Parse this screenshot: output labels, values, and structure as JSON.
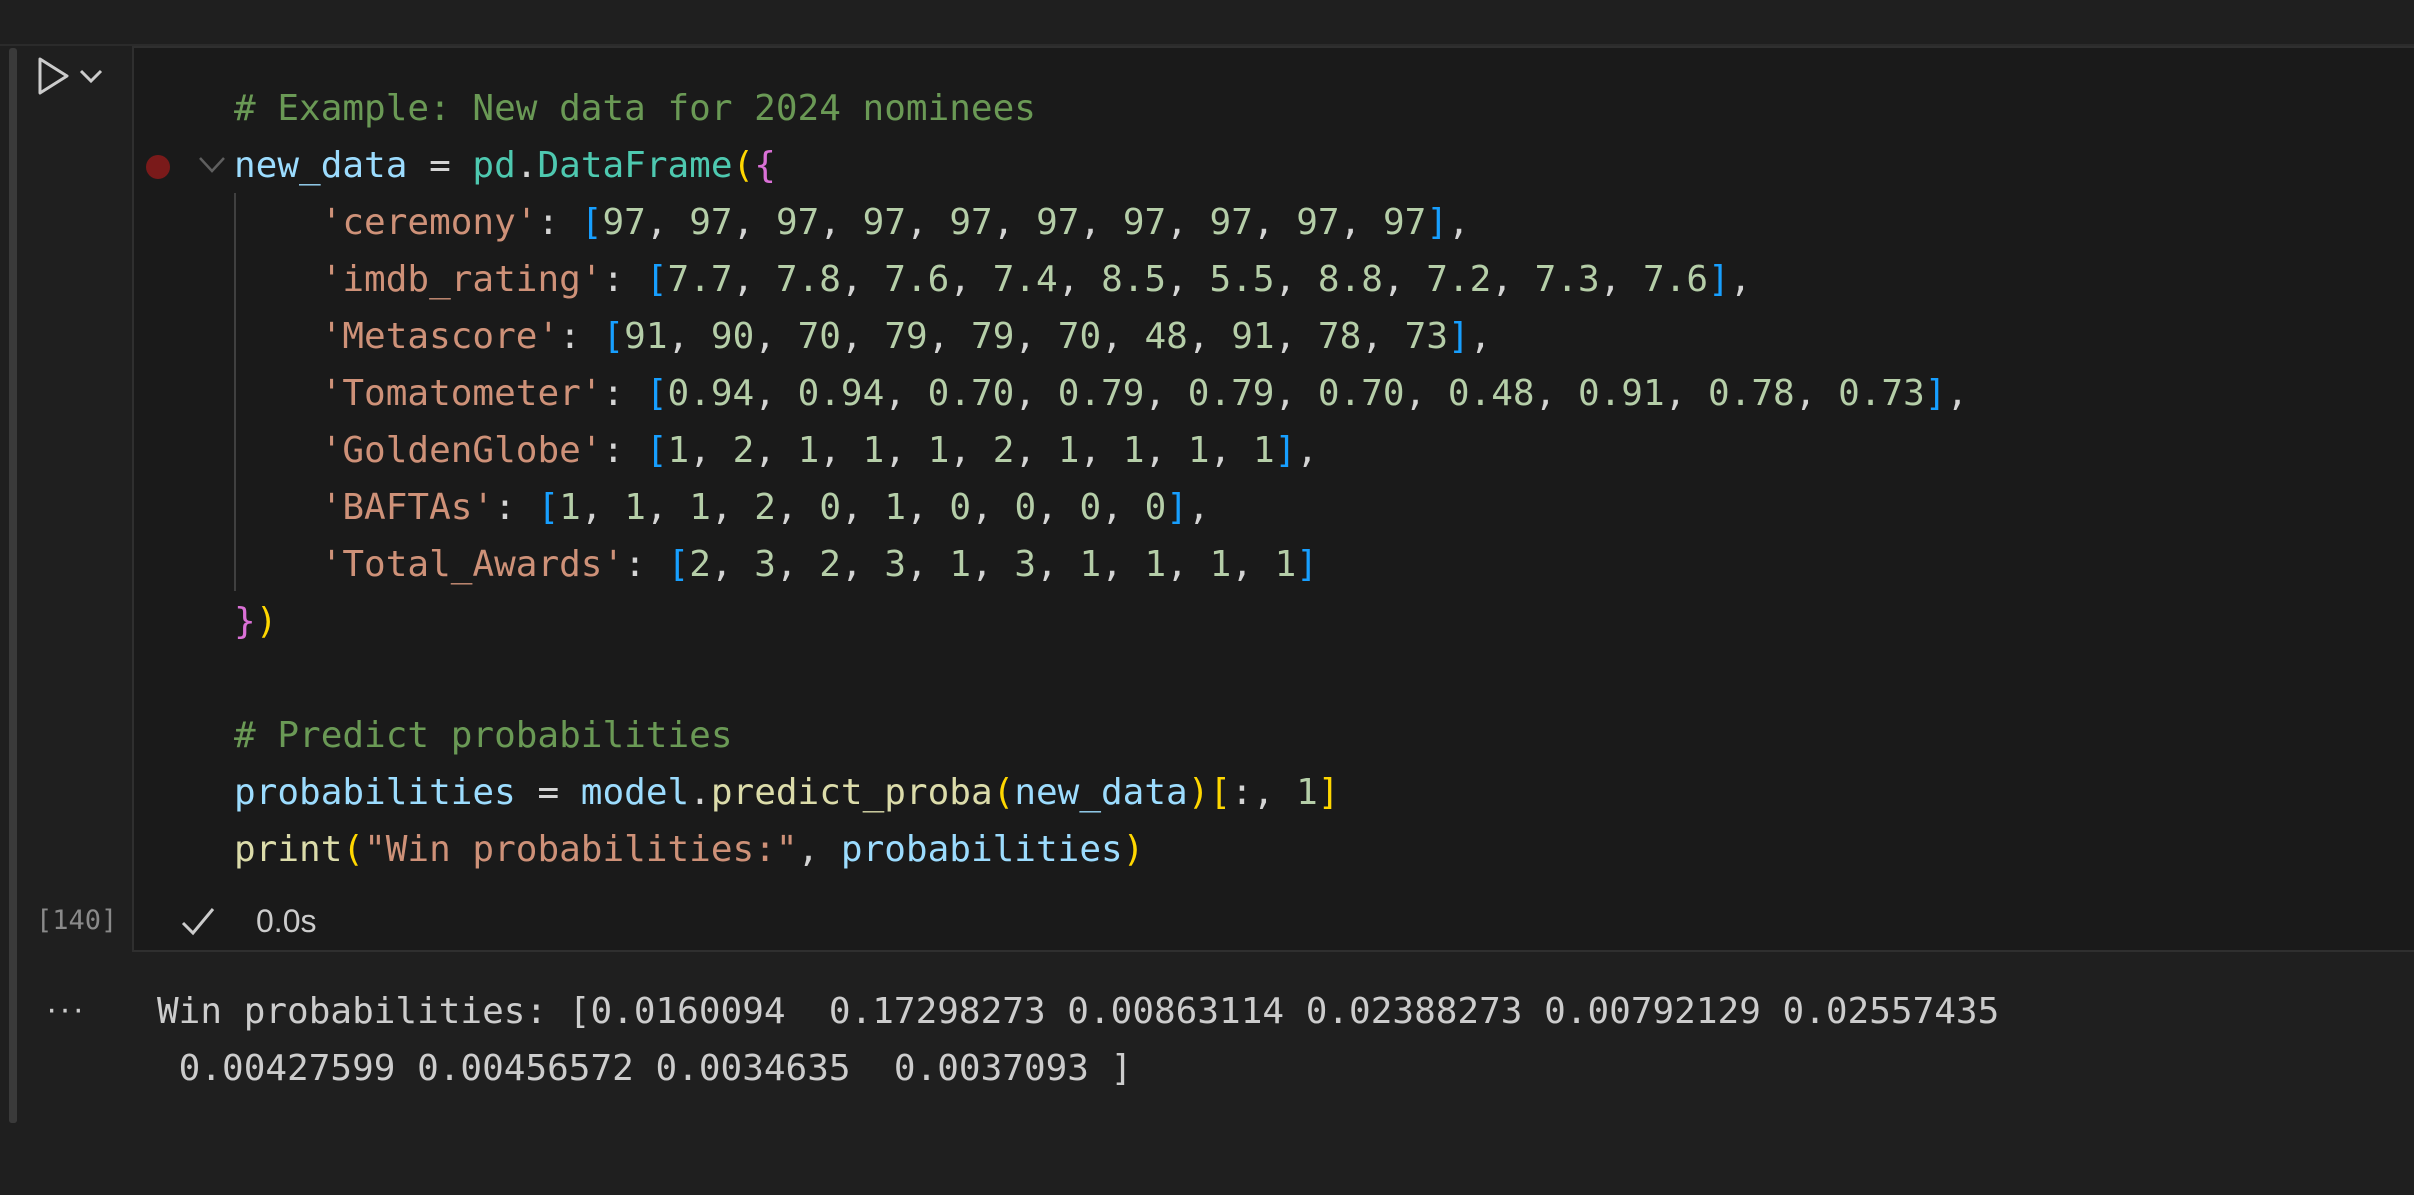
{
  "cell": {
    "execution_count": "[140]",
    "exec_time": "0.0s",
    "code_lines": [
      [
        [
          "tk-comment",
          "# Example: New data for 2024 nominees"
        ]
      ],
      [
        [
          "tk-var",
          "new_data"
        ],
        [
          "tk-op",
          " = "
        ],
        [
          "tk-cls",
          "pd"
        ],
        [
          "tk-op",
          "."
        ],
        [
          "tk-cls",
          "DataFrame"
        ],
        [
          "tk-b1",
          "("
        ],
        [
          "tk-b2",
          "{"
        ]
      ],
      [
        [
          "tk-plain",
          "    "
        ],
        [
          "tk-str",
          "'ceremony'"
        ],
        [
          "tk-plain",
          ": "
        ],
        [
          "tk-b3",
          "["
        ],
        [
          "tk-num",
          "97"
        ],
        [
          "tk-plain",
          ", "
        ],
        [
          "tk-num",
          "97"
        ],
        [
          "tk-plain",
          ", "
        ],
        [
          "tk-num",
          "97"
        ],
        [
          "tk-plain",
          ", "
        ],
        [
          "tk-num",
          "97"
        ],
        [
          "tk-plain",
          ", "
        ],
        [
          "tk-num",
          "97"
        ],
        [
          "tk-plain",
          ", "
        ],
        [
          "tk-num",
          "97"
        ],
        [
          "tk-plain",
          ", "
        ],
        [
          "tk-num",
          "97"
        ],
        [
          "tk-plain",
          ", "
        ],
        [
          "tk-num",
          "97"
        ],
        [
          "tk-plain",
          ", "
        ],
        [
          "tk-num",
          "97"
        ],
        [
          "tk-plain",
          ", "
        ],
        [
          "tk-num",
          "97"
        ],
        [
          "tk-b3",
          "]"
        ],
        [
          "tk-plain",
          ","
        ]
      ],
      [
        [
          "tk-plain",
          "    "
        ],
        [
          "tk-str",
          "'imdb_rating'"
        ],
        [
          "tk-plain",
          ": "
        ],
        [
          "tk-b3",
          "["
        ],
        [
          "tk-num",
          "7.7"
        ],
        [
          "tk-plain",
          ", "
        ],
        [
          "tk-num",
          "7.8"
        ],
        [
          "tk-plain",
          ", "
        ],
        [
          "tk-num",
          "7.6"
        ],
        [
          "tk-plain",
          ", "
        ],
        [
          "tk-num",
          "7.4"
        ],
        [
          "tk-plain",
          ", "
        ],
        [
          "tk-num",
          "8.5"
        ],
        [
          "tk-plain",
          ", "
        ],
        [
          "tk-num",
          "5.5"
        ],
        [
          "tk-plain",
          ", "
        ],
        [
          "tk-num",
          "8.8"
        ],
        [
          "tk-plain",
          ", "
        ],
        [
          "tk-num",
          "7.2"
        ],
        [
          "tk-plain",
          ", "
        ],
        [
          "tk-num",
          "7.3"
        ],
        [
          "tk-plain",
          ", "
        ],
        [
          "tk-num",
          "7.6"
        ],
        [
          "tk-b3",
          "]"
        ],
        [
          "tk-plain",
          ","
        ]
      ],
      [
        [
          "tk-plain",
          "    "
        ],
        [
          "tk-str",
          "'Metascore'"
        ],
        [
          "tk-plain",
          ": "
        ],
        [
          "tk-b3",
          "["
        ],
        [
          "tk-num",
          "91"
        ],
        [
          "tk-plain",
          ", "
        ],
        [
          "tk-num",
          "90"
        ],
        [
          "tk-plain",
          ", "
        ],
        [
          "tk-num",
          "70"
        ],
        [
          "tk-plain",
          ", "
        ],
        [
          "tk-num",
          "79"
        ],
        [
          "tk-plain",
          ", "
        ],
        [
          "tk-num",
          "79"
        ],
        [
          "tk-plain",
          ", "
        ],
        [
          "tk-num",
          "70"
        ],
        [
          "tk-plain",
          ", "
        ],
        [
          "tk-num",
          "48"
        ],
        [
          "tk-plain",
          ", "
        ],
        [
          "tk-num",
          "91"
        ],
        [
          "tk-plain",
          ", "
        ],
        [
          "tk-num",
          "78"
        ],
        [
          "tk-plain",
          ", "
        ],
        [
          "tk-num",
          "73"
        ],
        [
          "tk-b3",
          "]"
        ],
        [
          "tk-plain",
          ","
        ]
      ],
      [
        [
          "tk-plain",
          "    "
        ],
        [
          "tk-str",
          "'Tomatometer'"
        ],
        [
          "tk-plain",
          ": "
        ],
        [
          "tk-b3",
          "["
        ],
        [
          "tk-num",
          "0.94"
        ],
        [
          "tk-plain",
          ", "
        ],
        [
          "tk-num",
          "0.94"
        ],
        [
          "tk-plain",
          ", "
        ],
        [
          "tk-num",
          "0.70"
        ],
        [
          "tk-plain",
          ", "
        ],
        [
          "tk-num",
          "0.79"
        ],
        [
          "tk-plain",
          ", "
        ],
        [
          "tk-num",
          "0.79"
        ],
        [
          "tk-plain",
          ", "
        ],
        [
          "tk-num",
          "0.70"
        ],
        [
          "tk-plain",
          ", "
        ],
        [
          "tk-num",
          "0.48"
        ],
        [
          "tk-plain",
          ", "
        ],
        [
          "tk-num",
          "0.91"
        ],
        [
          "tk-plain",
          ", "
        ],
        [
          "tk-num",
          "0.78"
        ],
        [
          "tk-plain",
          ", "
        ],
        [
          "tk-num",
          "0.73"
        ],
        [
          "tk-b3",
          "]"
        ],
        [
          "tk-plain",
          ","
        ]
      ],
      [
        [
          "tk-plain",
          "    "
        ],
        [
          "tk-str",
          "'GoldenGlobe'"
        ],
        [
          "tk-plain",
          ": "
        ],
        [
          "tk-b3",
          "["
        ],
        [
          "tk-num",
          "1"
        ],
        [
          "tk-plain",
          ", "
        ],
        [
          "tk-num",
          "2"
        ],
        [
          "tk-plain",
          ", "
        ],
        [
          "tk-num",
          "1"
        ],
        [
          "tk-plain",
          ", "
        ],
        [
          "tk-num",
          "1"
        ],
        [
          "tk-plain",
          ", "
        ],
        [
          "tk-num",
          "1"
        ],
        [
          "tk-plain",
          ", "
        ],
        [
          "tk-num",
          "2"
        ],
        [
          "tk-plain",
          ", "
        ],
        [
          "tk-num",
          "1"
        ],
        [
          "tk-plain",
          ", "
        ],
        [
          "tk-num",
          "1"
        ],
        [
          "tk-plain",
          ", "
        ],
        [
          "tk-num",
          "1"
        ],
        [
          "tk-plain",
          ", "
        ],
        [
          "tk-num",
          "1"
        ],
        [
          "tk-b3",
          "]"
        ],
        [
          "tk-plain",
          ","
        ]
      ],
      [
        [
          "tk-plain",
          "    "
        ],
        [
          "tk-str",
          "'BAFTAs'"
        ],
        [
          "tk-plain",
          ": "
        ],
        [
          "tk-b3",
          "["
        ],
        [
          "tk-num",
          "1"
        ],
        [
          "tk-plain",
          ", "
        ],
        [
          "tk-num",
          "1"
        ],
        [
          "tk-plain",
          ", "
        ],
        [
          "tk-num",
          "1"
        ],
        [
          "tk-plain",
          ", "
        ],
        [
          "tk-num",
          "2"
        ],
        [
          "tk-plain",
          ", "
        ],
        [
          "tk-num",
          "0"
        ],
        [
          "tk-plain",
          ", "
        ],
        [
          "tk-num",
          "1"
        ],
        [
          "tk-plain",
          ", "
        ],
        [
          "tk-num",
          "0"
        ],
        [
          "tk-plain",
          ", "
        ],
        [
          "tk-num",
          "0"
        ],
        [
          "tk-plain",
          ", "
        ],
        [
          "tk-num",
          "0"
        ],
        [
          "tk-plain",
          ", "
        ],
        [
          "tk-num",
          "0"
        ],
        [
          "tk-b3",
          "]"
        ],
        [
          "tk-plain",
          ","
        ]
      ],
      [
        [
          "tk-plain",
          "    "
        ],
        [
          "tk-str",
          "'Total_Awards'"
        ],
        [
          "tk-plain",
          ": "
        ],
        [
          "tk-b3",
          "["
        ],
        [
          "tk-num",
          "2"
        ],
        [
          "tk-plain",
          ", "
        ],
        [
          "tk-num",
          "3"
        ],
        [
          "tk-plain",
          ", "
        ],
        [
          "tk-num",
          "2"
        ],
        [
          "tk-plain",
          ", "
        ],
        [
          "tk-num",
          "3"
        ],
        [
          "tk-plain",
          ", "
        ],
        [
          "tk-num",
          "1"
        ],
        [
          "tk-plain",
          ", "
        ],
        [
          "tk-num",
          "3"
        ],
        [
          "tk-plain",
          ", "
        ],
        [
          "tk-num",
          "1"
        ],
        [
          "tk-plain",
          ", "
        ],
        [
          "tk-num",
          "1"
        ],
        [
          "tk-plain",
          ", "
        ],
        [
          "tk-num",
          "1"
        ],
        [
          "tk-plain",
          ", "
        ],
        [
          "tk-num",
          "1"
        ],
        [
          "tk-b3",
          "]"
        ]
      ],
      [
        [
          "tk-b2",
          "}"
        ],
        [
          "tk-b1",
          ")"
        ]
      ],
      [],
      [
        [
          "tk-comment",
          "# Predict probabilities"
        ]
      ],
      [
        [
          "tk-var",
          "probabilities"
        ],
        [
          "tk-op",
          " = "
        ],
        [
          "tk-var",
          "model"
        ],
        [
          "tk-op",
          "."
        ],
        [
          "tk-fn",
          "predict_proba"
        ],
        [
          "tk-b1",
          "("
        ],
        [
          "tk-var",
          "new_data"
        ],
        [
          "tk-b1",
          ")"
        ],
        [
          "tk-b1",
          "["
        ],
        [
          "tk-plain",
          ":, "
        ],
        [
          "tk-num",
          "1"
        ],
        [
          "tk-b1",
          "]"
        ]
      ],
      [
        [
          "tk-fn",
          "print"
        ],
        [
          "tk-b1",
          "("
        ],
        [
          "tk-str",
          "\"Win probabilities:\""
        ],
        [
          "tk-plain",
          ", "
        ],
        [
          "tk-var",
          "probabilities"
        ],
        [
          "tk-b1",
          ")"
        ]
      ]
    ]
  },
  "output": {
    "menu_label": "···",
    "lines": [
      "Win probabilities: [0.0160094  0.17298273 0.00863114 0.02388273 0.00792129 0.02557435",
      " 0.00427599 0.00456572 0.0034635  0.0037093 ]"
    ]
  }
}
